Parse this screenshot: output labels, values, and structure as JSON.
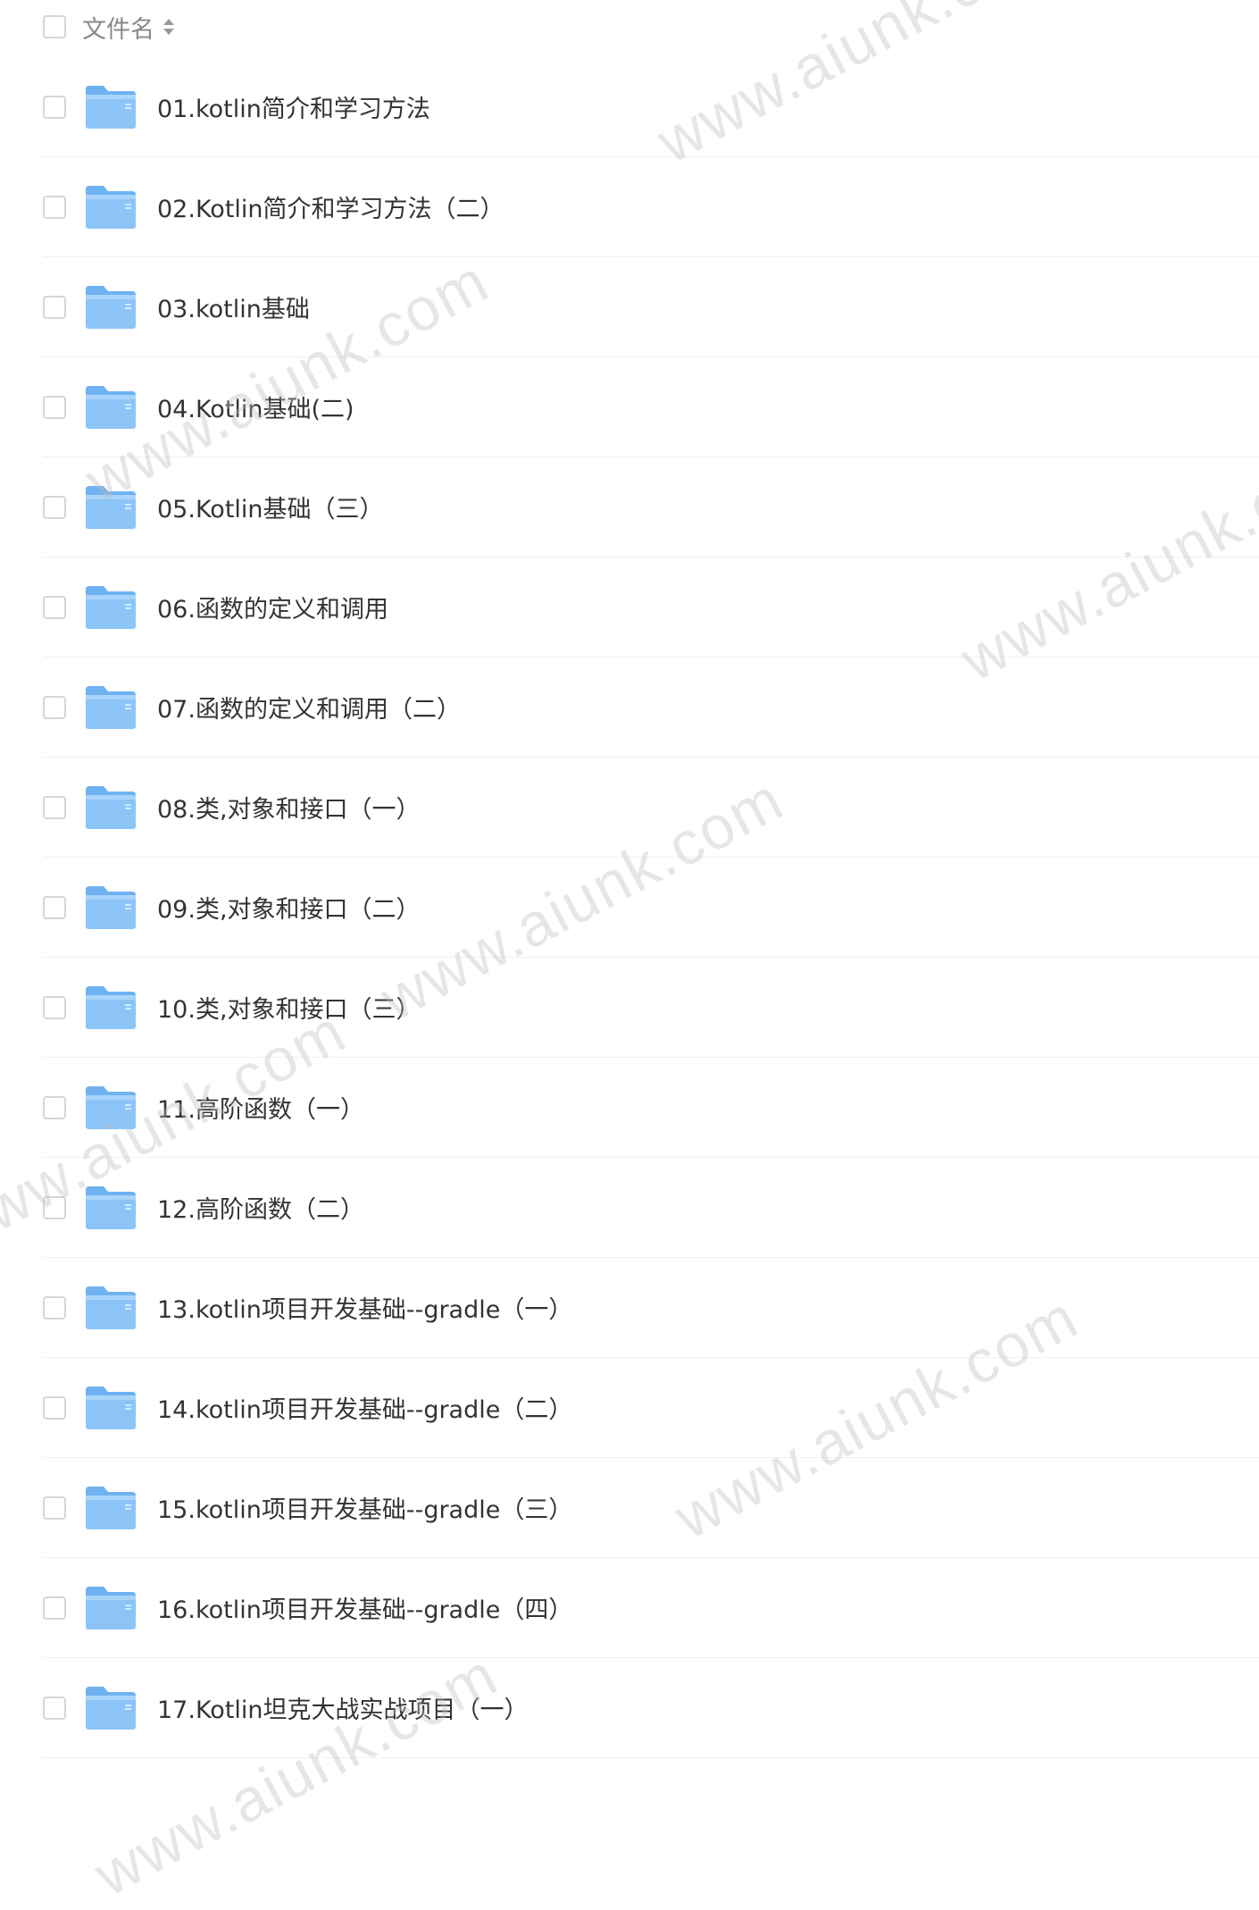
{
  "header": {
    "column_label": "文件名"
  },
  "icons": {
    "folder": "folder-icon",
    "sort": "sort-icon"
  },
  "colors": {
    "folder_body": "#8cc4f7",
    "folder_tab": "#6fb2f2",
    "checkbox_border": "#d6d6d6",
    "text": "#333333",
    "header_text": "#888888"
  },
  "rows": [
    {
      "name": "01.kotlin简介和学习方法"
    },
    {
      "name": "02.Kotlin简介和学习方法（二）"
    },
    {
      "name": "03.kotlin基础"
    },
    {
      "name": "04.Kotlin基础(二)"
    },
    {
      "name": "05.Kotlin基础（三）"
    },
    {
      "name": "06.函数的定义和调用"
    },
    {
      "name": "07.函数的定义和调用（二）"
    },
    {
      "name": "08.类,对象和接口（一）"
    },
    {
      "name": "09.类,对象和接口（二）"
    },
    {
      "name": "10.类,对象和接口（三）"
    },
    {
      "name": "11.高阶函数（一）"
    },
    {
      "name": "12.高阶函数（二）"
    },
    {
      "name": "13.kotlin项目开发基础--gradle（一）"
    },
    {
      "name": "14.kotlin项目开发基础--gradle（二）"
    },
    {
      "name": "15.kotlin项目开发基础--gradle（三）"
    },
    {
      "name": "16.kotlin项目开发基础--gradle（四）"
    },
    {
      "name": "17.Kotlin坦克大战实战项目（一）"
    }
  ],
  "watermark": {
    "text": "www.aiunk.com"
  }
}
